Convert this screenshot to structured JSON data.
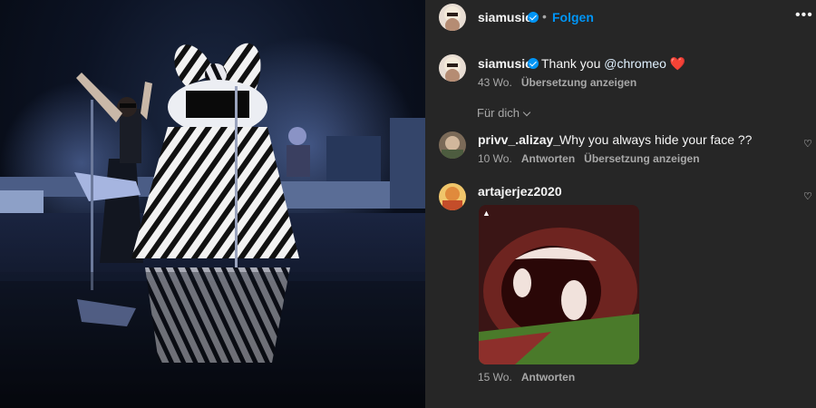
{
  "post": {
    "author": "siamusic",
    "follow_label": "Folgen",
    "separator": "•",
    "more_label": "•••",
    "media_alt": "concert-photo"
  },
  "caption": {
    "author": "siamusic",
    "text_before": "Thank you ",
    "mention": "@chromeo",
    "emoji": "❤️",
    "age": "43 Wo.",
    "translate_label": "Übersetzung anzeigen"
  },
  "filter": {
    "label": "Für dich"
  },
  "comments": [
    {
      "author": "privv_.alizay_",
      "text": "Why you always hide your face ??",
      "age": "10 Wo.",
      "reply_label": "Antworten",
      "translate_label": "Übersetzung anzeigen",
      "like_icon": "heart-outline-icon"
    },
    {
      "author": "artajerjez2020",
      "text": "",
      "age": "15 Wo.",
      "reply_label": "Antworten",
      "attachment": "gif-open-mouth",
      "like_icon": "heart-outline-icon"
    }
  ],
  "colors": {
    "panel_bg": "#262626",
    "text_primary": "#f5f5f5",
    "text_secondary": "#a8a8a8",
    "accent": "#0095f6",
    "heart_emoji": "#e8453c"
  }
}
